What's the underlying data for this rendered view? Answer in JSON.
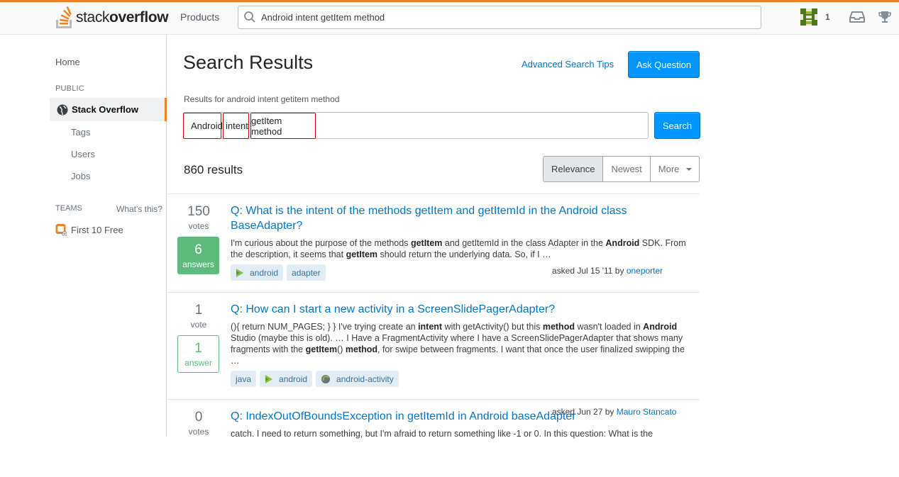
{
  "header": {
    "logo_prefix": "stack",
    "logo_bold": "overflow",
    "products": "Products",
    "search_value": "Android intent getItem method",
    "reputation": "1"
  },
  "sidebar": {
    "home": "Home",
    "public_heading": "PUBLIC",
    "stack_overflow": "Stack Overflow",
    "tags": "Tags",
    "users": "Users",
    "jobs": "Jobs",
    "teams_heading": "TEAMS",
    "whats_this": "What's this?",
    "first_free": "First 10 Free"
  },
  "main": {
    "title": "Search Results",
    "advanced_tips": "Advanced Search Tips",
    "ask_question": "Ask Question",
    "results_for": "Results for android intent getitem method",
    "tokens": [
      "Android",
      "intent",
      "getItem method"
    ],
    "search_button": "Search",
    "result_count": "860 results",
    "sort": [
      "Relevance",
      "Newest",
      "More"
    ]
  },
  "results": [
    {
      "votes": "150",
      "votes_label": "votes",
      "answers": "6",
      "answers_label": "answers",
      "title_line1": "Q: What is the intent of the methods getItem and getItemId in the Android class",
      "title_line2": "BaseAdapter?",
      "excerpt": [
        {
          "t": "I'm curious about the purpose of the methods "
        },
        {
          "b": "getItem"
        },
        {
          "t": " and getItemId in the class Adapter in the "
        },
        {
          "b": "Android"
        },
        {
          "t": " SDK. From the description, it seems that "
        },
        {
          "b": "getItem"
        },
        {
          "t": " should return the underlying data. So, if I …"
        }
      ],
      "tags": [
        "android",
        "adapter"
      ],
      "asked": "asked Jul 15 '11 by",
      "user": "oneporter"
    },
    {
      "votes": "1",
      "votes_label": "vote",
      "answers": "1",
      "answers_label": "answer",
      "title_line1": "Q: How can I start a new activity in a ScreenSlidePagerAdapter?",
      "excerpt": [
        {
          "t": "(){ return NUM_PAGES; } } I've trying create an "
        },
        {
          "b": "intent"
        },
        {
          "t": " with getActivity() but this "
        },
        {
          "b": "method"
        },
        {
          "t": " wasn't loaded in "
        },
        {
          "b": "Android"
        },
        {
          "t": " Studio (maybe this is old). … I Have a FragmentActivity where I have a ScreenSlidePagerAdapter that shows many fragments with the "
        },
        {
          "b": "getItem"
        },
        {
          "t": "() "
        },
        {
          "b": "method"
        },
        {
          "t": ", for swipe between fragments. I want that once the user finalized swipping the …"
        }
      ],
      "tags": [
        "java",
        "android",
        "android-activity"
      ],
      "asked": "asked Jun 27 by",
      "user": "Mauro Stancato"
    },
    {
      "votes": "0",
      "votes_label": "votes",
      "title_line1": "Q: IndexOutOfBoundsException in getItemId in Android baseAdapter",
      "excerpt_text": "catch. I need to return something, but I'm afraid to return something like -1 or 0. In this question: What is the"
    }
  ],
  "colors": {
    "accent": "#f48024",
    "link": "#0077cc",
    "primary_button": "#0095ff",
    "accepted": "#5eba7d",
    "tag_bg": "#e1ecf4"
  }
}
